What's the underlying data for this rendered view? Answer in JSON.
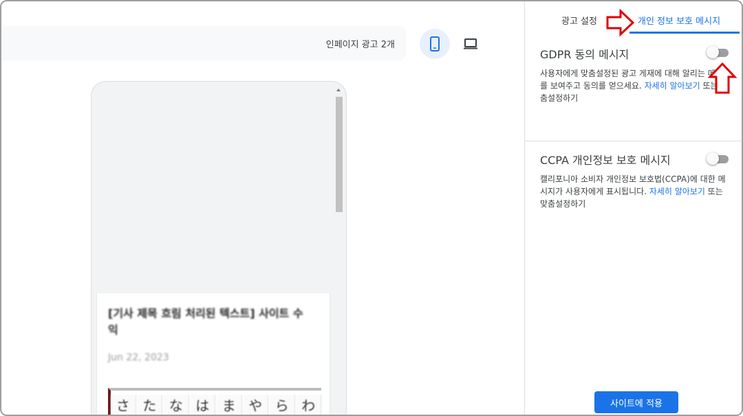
{
  "preview": {
    "ad_count_label": "인페이지 광고 2개",
    "device_mobile_icon": "smartphone-icon",
    "device_desktop_icon": "laptop-icon"
  },
  "article": {
    "title": "[기사 제목 흐림 처리된 텍스트] 사이트 수익",
    "date": "Jun 22, 2023",
    "kana": [
      "さ",
      "た",
      "な",
      "は",
      "ま",
      "や",
      "ら",
      "わ"
    ]
  },
  "panel": {
    "tabs": [
      {
        "label": "광고 설정"
      },
      {
        "label": "개인 정보 보호 메시지"
      }
    ],
    "gdpr": {
      "title": "GDPR 동의 메시지",
      "desc_text": "사용자에게 맞춤설정된 광고 게재에 대해 알리는 메시지를 보여주고 동의를 얻으세요.",
      "desc_link": "자세히 알아보기",
      "desc_tail": "또는 맞춤설정하기",
      "enabled": false
    },
    "ccpa": {
      "title": "CCPA 개인정보 보호 메시지",
      "desc_text": "캘리포니아 소비자 개인정보 보호법(CCPA)에 대한 메시지가 사용자에게 표시됩니다.",
      "desc_link": "자세히 알아보기",
      "desc_tail": "또는 맞춤설정하기",
      "enabled": false
    },
    "apply_label": "사이트에 적용"
  },
  "colors": {
    "accent": "#1a73e8",
    "annotation": "#e00000"
  }
}
